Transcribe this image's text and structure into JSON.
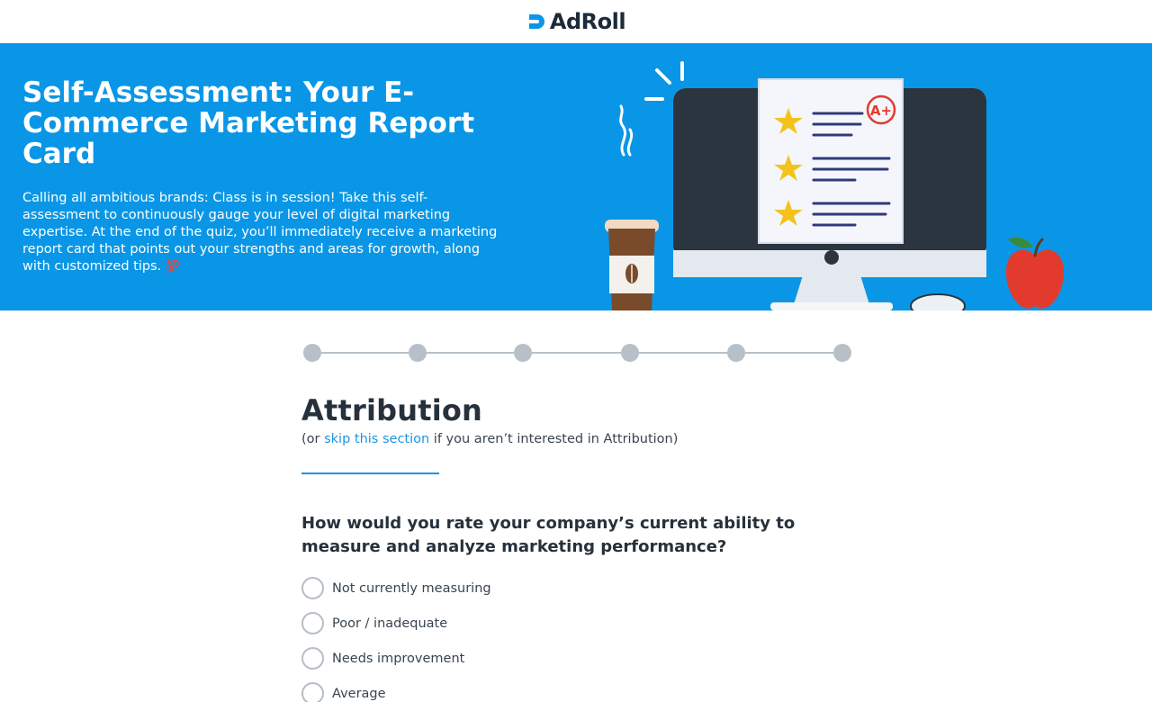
{
  "header": {
    "brand": "AdRoll"
  },
  "hero": {
    "title": "Self-Assessment: Your E-Commerce Marketing Report Card",
    "description": "Calling all ambitious brands: Class is in session! Take this self-assessment to continuously gauge your level of digital marketing expertise. At the end of the quiz, you’ll immediately receive a marketing report card that points out your strengths and areas for growth, along with customized tips.",
    "emoji": "💯",
    "grade_badge": "A+"
  },
  "progress": {
    "total_steps": 6,
    "current_step": 1
  },
  "section": {
    "title": "Attribution",
    "sub_prefix": "(or ",
    "skip_link": "skip this section",
    "sub_suffix": " if you aren’t interested in Attribution)"
  },
  "question": {
    "text": "How would you rate your company’s current ability to measure and analyze marketing performance?",
    "options": [
      {
        "label": "Not currently measuring",
        "selected": false
      },
      {
        "label": "Poor / inadequate",
        "selected": false
      },
      {
        "label": "Needs improvement",
        "selected": false
      },
      {
        "label": "Average",
        "selected": false
      }
    ]
  },
  "colors": {
    "hero_bg": "#0a96e6",
    "accent": "#1e95e0",
    "step_inactive": "#b7c0c8",
    "heading": "#26313c"
  }
}
